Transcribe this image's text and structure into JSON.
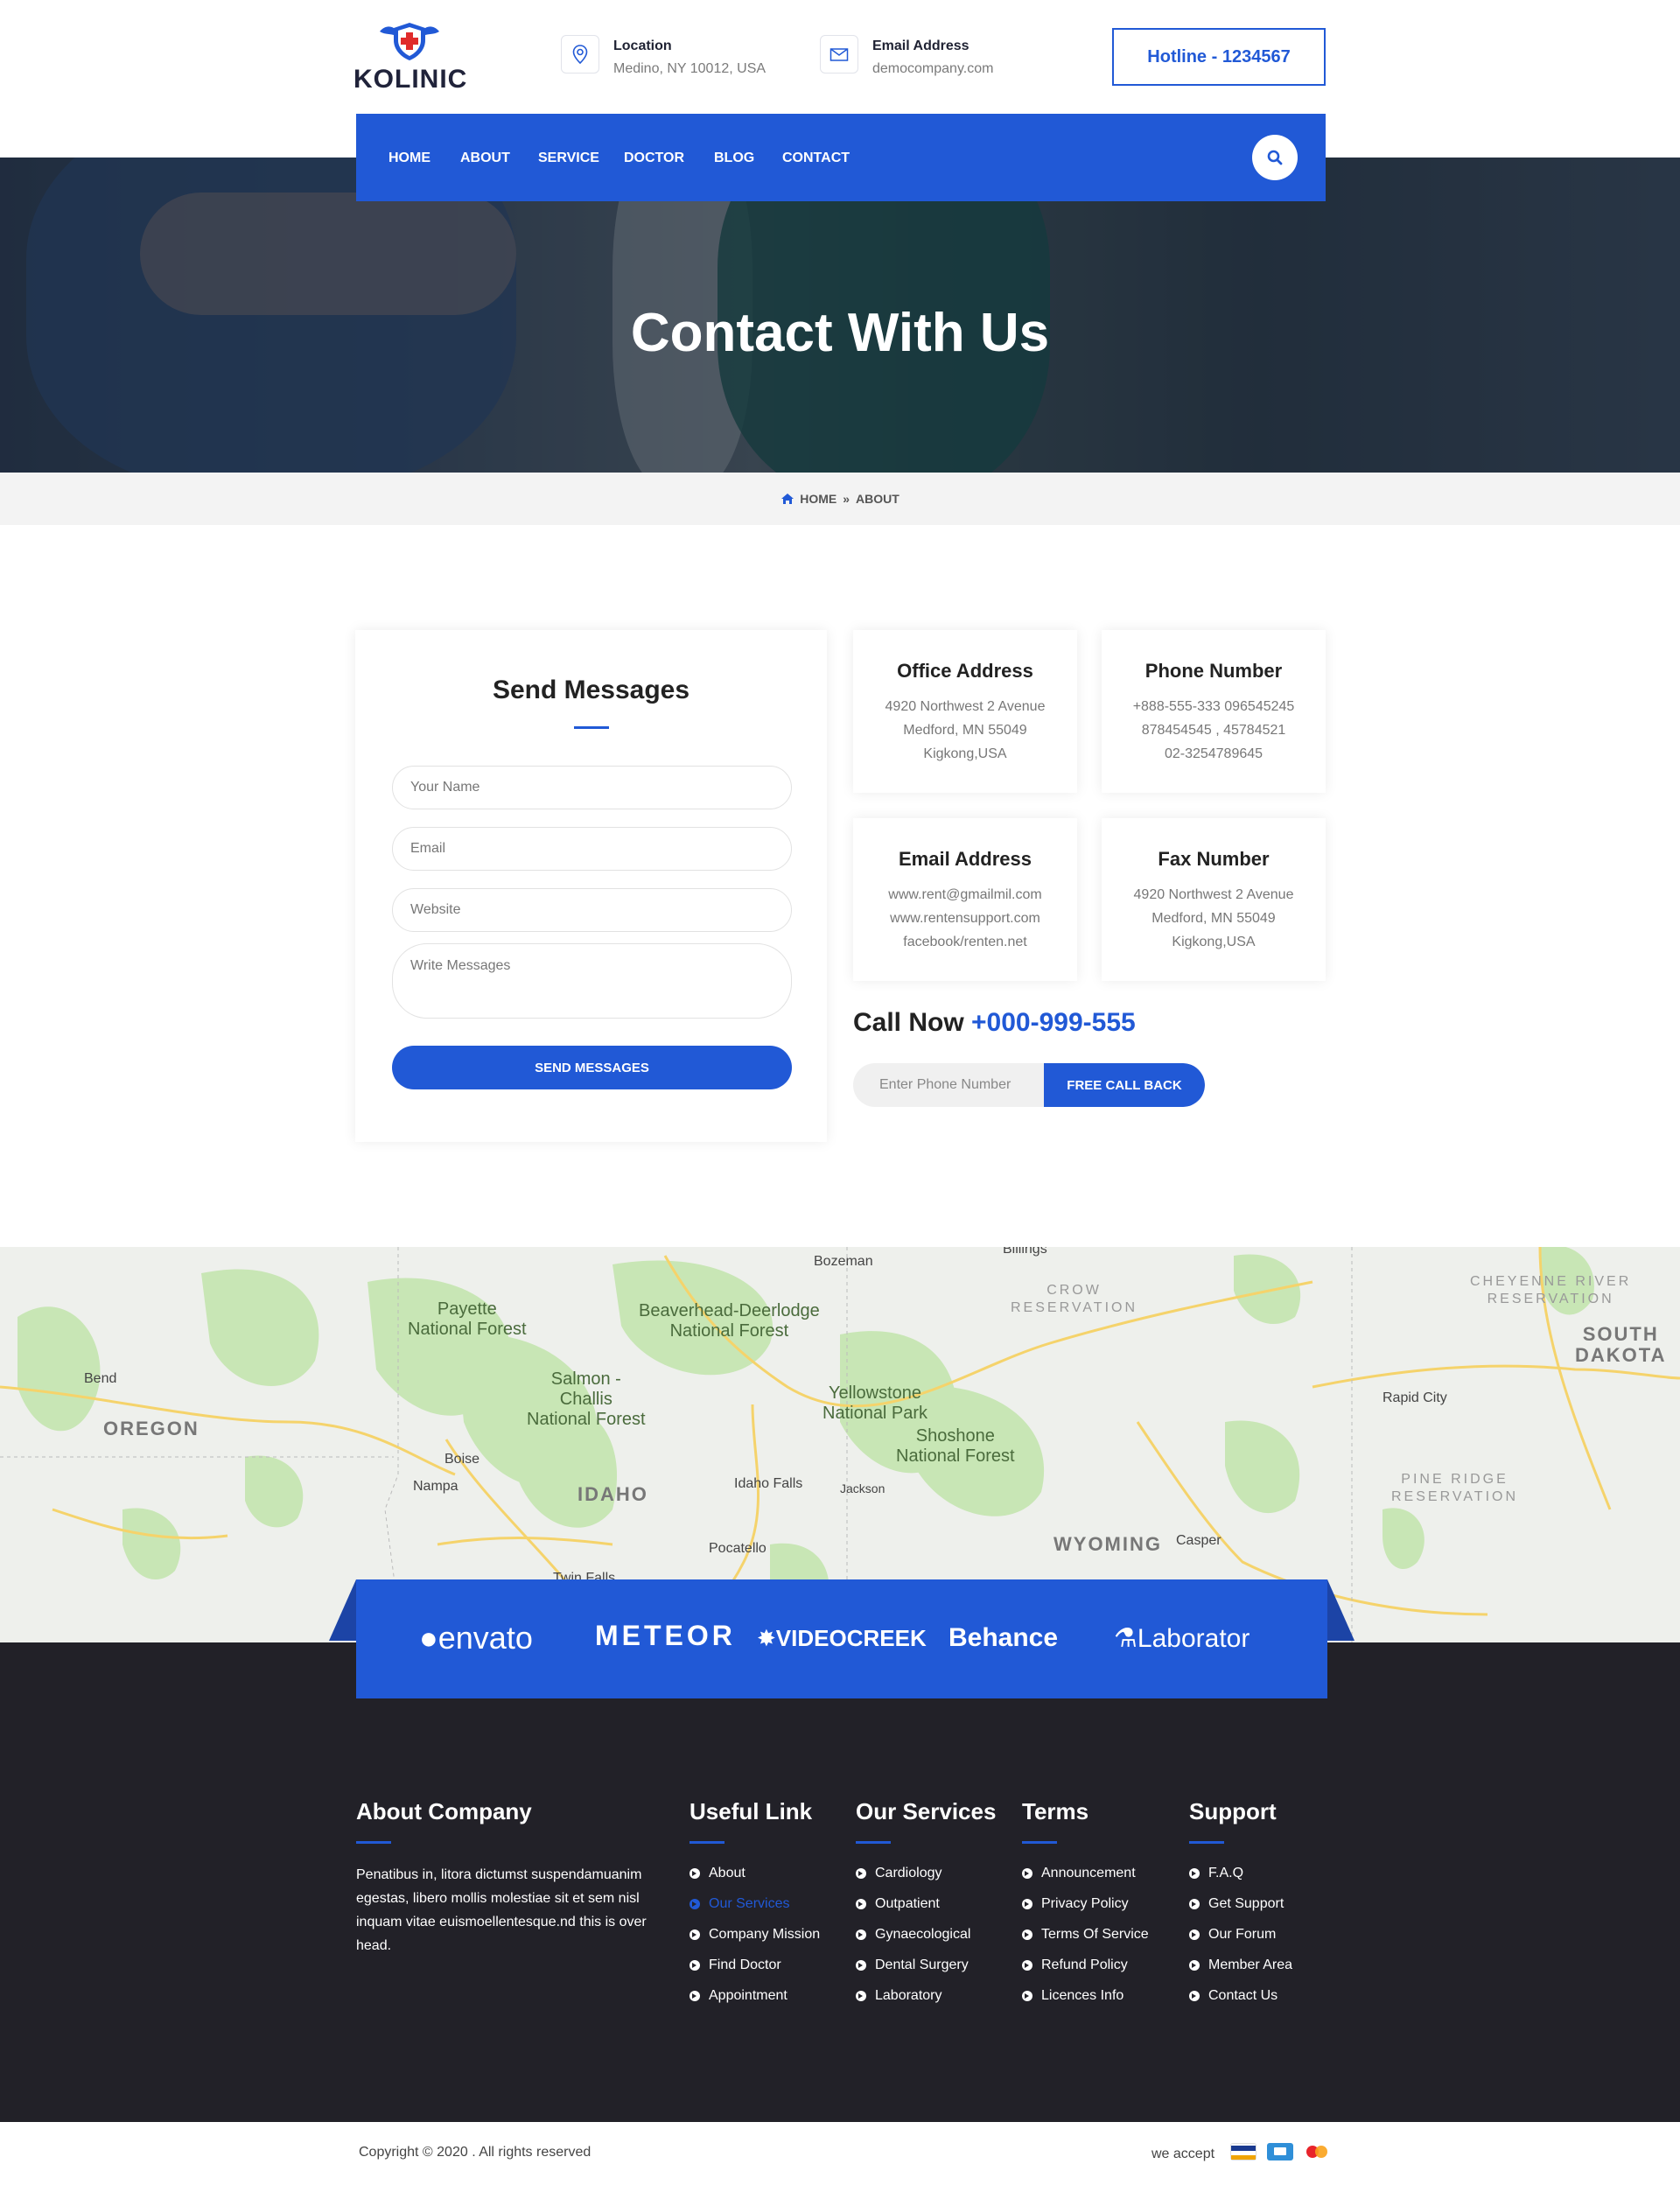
{
  "brand": {
    "name": "KOLINIC"
  },
  "header": {
    "location": {
      "title": "Location",
      "value": "Medino, NY 10012, USA",
      "icon": "map-pin-icon"
    },
    "email": {
      "title": "Email Address",
      "value": "democompany.com",
      "icon": "envelope-icon"
    },
    "hotline": "Hotline - 1234567"
  },
  "nav": {
    "items": [
      "HOME",
      "ABOUT",
      "SERVICE",
      "DOCTOR",
      "BLOG",
      "CONTACT"
    ],
    "search_icon": "search-icon"
  },
  "hero": {
    "title": "Contact With Us"
  },
  "breadcrumb": {
    "home": "HOME",
    "current": "ABOUT",
    "home_icon": "home-icon",
    "separator_icon": "double-chevron-right-icon"
  },
  "form": {
    "title": "Send Messages",
    "name_placeholder": "Your Name",
    "email_placeholder": "Email",
    "website_placeholder": "Website",
    "message_placeholder": "Write Messages",
    "submit": "SEND MESSAGES"
  },
  "cards": [
    {
      "title": "Office Address",
      "lines": [
        "4920 Northwest 2 Avenue",
        "Medford, MN 55049",
        "Kigkong,USA"
      ]
    },
    {
      "title": "Phone Number",
      "lines": [
        "+888-555-333 096545245",
        "878454545 , 45784521",
        "02-3254789645"
      ]
    },
    {
      "title": "Email Address",
      "lines": [
        "www.rent@gmailmil.com",
        "www.rentensupport.com",
        "facebook/renten.net"
      ]
    },
    {
      "title": "Fax Number",
      "lines": [
        "4920 Northwest 2 Avenue",
        "Medford, MN 55049",
        "Kigkong,USA"
      ]
    }
  ],
  "callnow": {
    "label": "Call Now",
    "number": "+000-999-555",
    "phone_placeholder": "Enter Phone Number",
    "button": "FREE CALL BACK"
  },
  "map": {
    "labels": {
      "payette": "Payette\nNational Forest",
      "beaverhead": "Beaverhead-Deerlodge\nNational Forest",
      "salmon": "Salmon -\nChallis\nNational Forest",
      "yellowstone": "Yellowstone\nNational Park",
      "shoshone": "Shoshone\nNational Forest",
      "crow": "CROW\nRESERVATION",
      "cheyenne": "CHEYENNE RIVER\nRESERVATION",
      "pineridge": "PINE RIDGE\nRESERVATION",
      "oregon": "OREGON",
      "idaho": "IDAHO",
      "wyoming": "WYOMING",
      "southdakota": "SOUTH\nDAKOTA",
      "bend": "Bend",
      "boise": "Boise",
      "nampa": "Nampa",
      "idahofalls": "Idaho Falls",
      "jackson": "Jackson",
      "pocatello": "Pocatello",
      "twinfalls": "Twin Falls",
      "casper": "Casper",
      "rapidcity": "Rapid City",
      "bozeman": "Bozeman",
      "billings": "Billings"
    }
  },
  "partners": [
    "envato",
    "METEOR",
    "VIDEOCREEK",
    "Behance",
    "Laborator"
  ],
  "footer": {
    "about": {
      "title": "About Company",
      "text": "Penatibus in, litora dictumst suspendamuanim egestas, libero mollis molestiae sit et sem nisl inquam vitae euismoellentesque.nd this is over head."
    },
    "useful": {
      "title": "Useful Link",
      "links": [
        "About",
        "Our Services",
        "Company Mission",
        "Find Doctor",
        "Appointment"
      ]
    },
    "services": {
      "title": "Our Services",
      "links": [
        "Cardiology",
        "Outpatient",
        "Gynaecological",
        "Dental Surgery",
        "Laboratory"
      ]
    },
    "terms": {
      "title": "Terms",
      "links": [
        "Announcement",
        "Privacy Policy",
        "Terms Of Service",
        "Refund Policy",
        "Licences Info"
      ]
    },
    "support": {
      "title": "Support",
      "links": [
        "F.A.Q",
        "Get Support",
        "Our Forum",
        "Member Area",
        "Contact Us"
      ]
    }
  },
  "bottom": {
    "copyright": "Copyright © 2020 . All rights reserved",
    "accept": "we accept",
    "payment_icons": [
      "visa-icon",
      "amex-icon",
      "mastercard-icon"
    ]
  },
  "colors": {
    "primary": "#2159d6",
    "footer_bg": "#222128"
  }
}
